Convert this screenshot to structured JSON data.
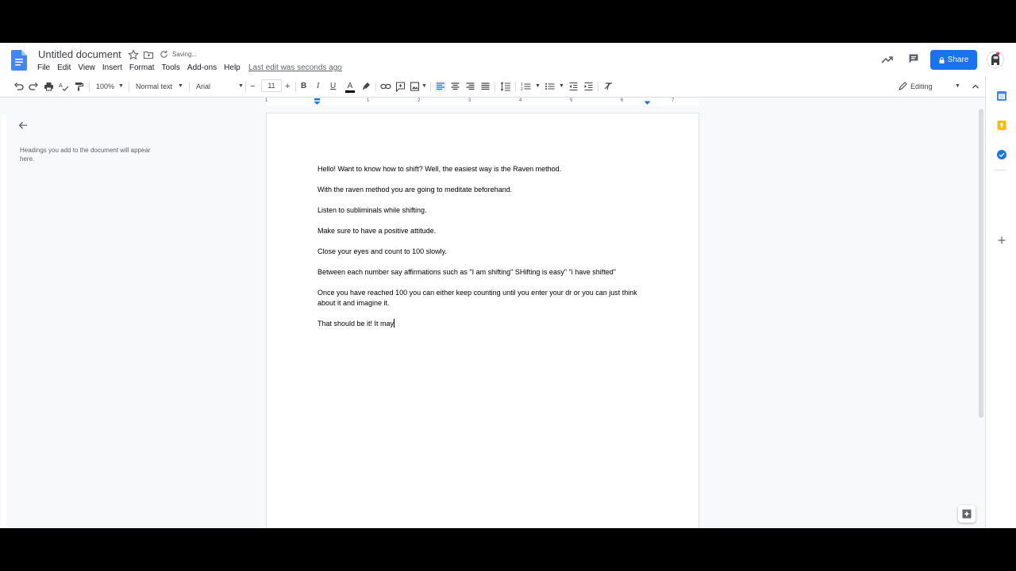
{
  "header": {
    "title": "Untitled document",
    "saving": "Saving...",
    "last_edit": "Last edit was seconds ago",
    "share_label": "Share",
    "menu": [
      "File",
      "Edit",
      "View",
      "Insert",
      "Format",
      "Tools",
      "Add-ons",
      "Help"
    ]
  },
  "toolbar": {
    "zoom": "100%",
    "style": "Normal text",
    "font": "Arial",
    "font_size": "11",
    "mode": "Editing"
  },
  "ruler": {
    "numbers": [
      "1",
      "1",
      "2",
      "3",
      "4",
      "5",
      "6",
      "7"
    ]
  },
  "outline": {
    "hint": "Headings you add to the document will appear here."
  },
  "document": {
    "paragraphs": [
      "Hello! Want to know how to shift? Well, the easiest way is the Raven method.",
      "With the raven method you are going to meditate beforehand.",
      "Listen to subliminals while shifting.",
      "Make sure to have a positive attitude.",
      "Close your eyes and count to 100 slowly.",
      "Between each number say affirmations such as \"I am shifting\" SHifting is easy\" \"i have shifted\"",
      "Once you have reached 100 you can either keep counting until you enter your dr or you can just think about it and imagine it.",
      "That should be it! It may"
    ]
  },
  "colors": {
    "accent": "#1a73e8",
    "text_color_bar": "#000000",
    "keep_icon": "#fbbc04",
    "calendar_icon": "#4285f4",
    "tasks_icon": "#1a73e8"
  },
  "icons": [
    "docs-logo-icon",
    "star-icon",
    "folder-icon",
    "sync-icon",
    "trending-icon",
    "comment-icon",
    "lock-icon",
    "avatar-icon",
    "undo-icon",
    "redo-icon",
    "print-icon",
    "spellcheck-icon",
    "paint-format-icon",
    "bold-icon",
    "italic-icon",
    "underline-icon",
    "text-color-icon",
    "highlight-icon",
    "link-icon",
    "add-comment-icon",
    "image-icon",
    "align-left-icon",
    "align-center-icon",
    "align-right-icon",
    "justify-icon",
    "line-spacing-icon",
    "numbered-list-icon",
    "bulleted-list-icon",
    "decrease-indent-icon",
    "increase-indent-icon",
    "clear-formatting-icon",
    "pencil-icon",
    "collapse-icon",
    "back-arrow-icon",
    "calendar-icon",
    "keep-icon",
    "tasks-icon",
    "plus-icon",
    "explore-icon",
    "chevron-right-icon"
  ]
}
